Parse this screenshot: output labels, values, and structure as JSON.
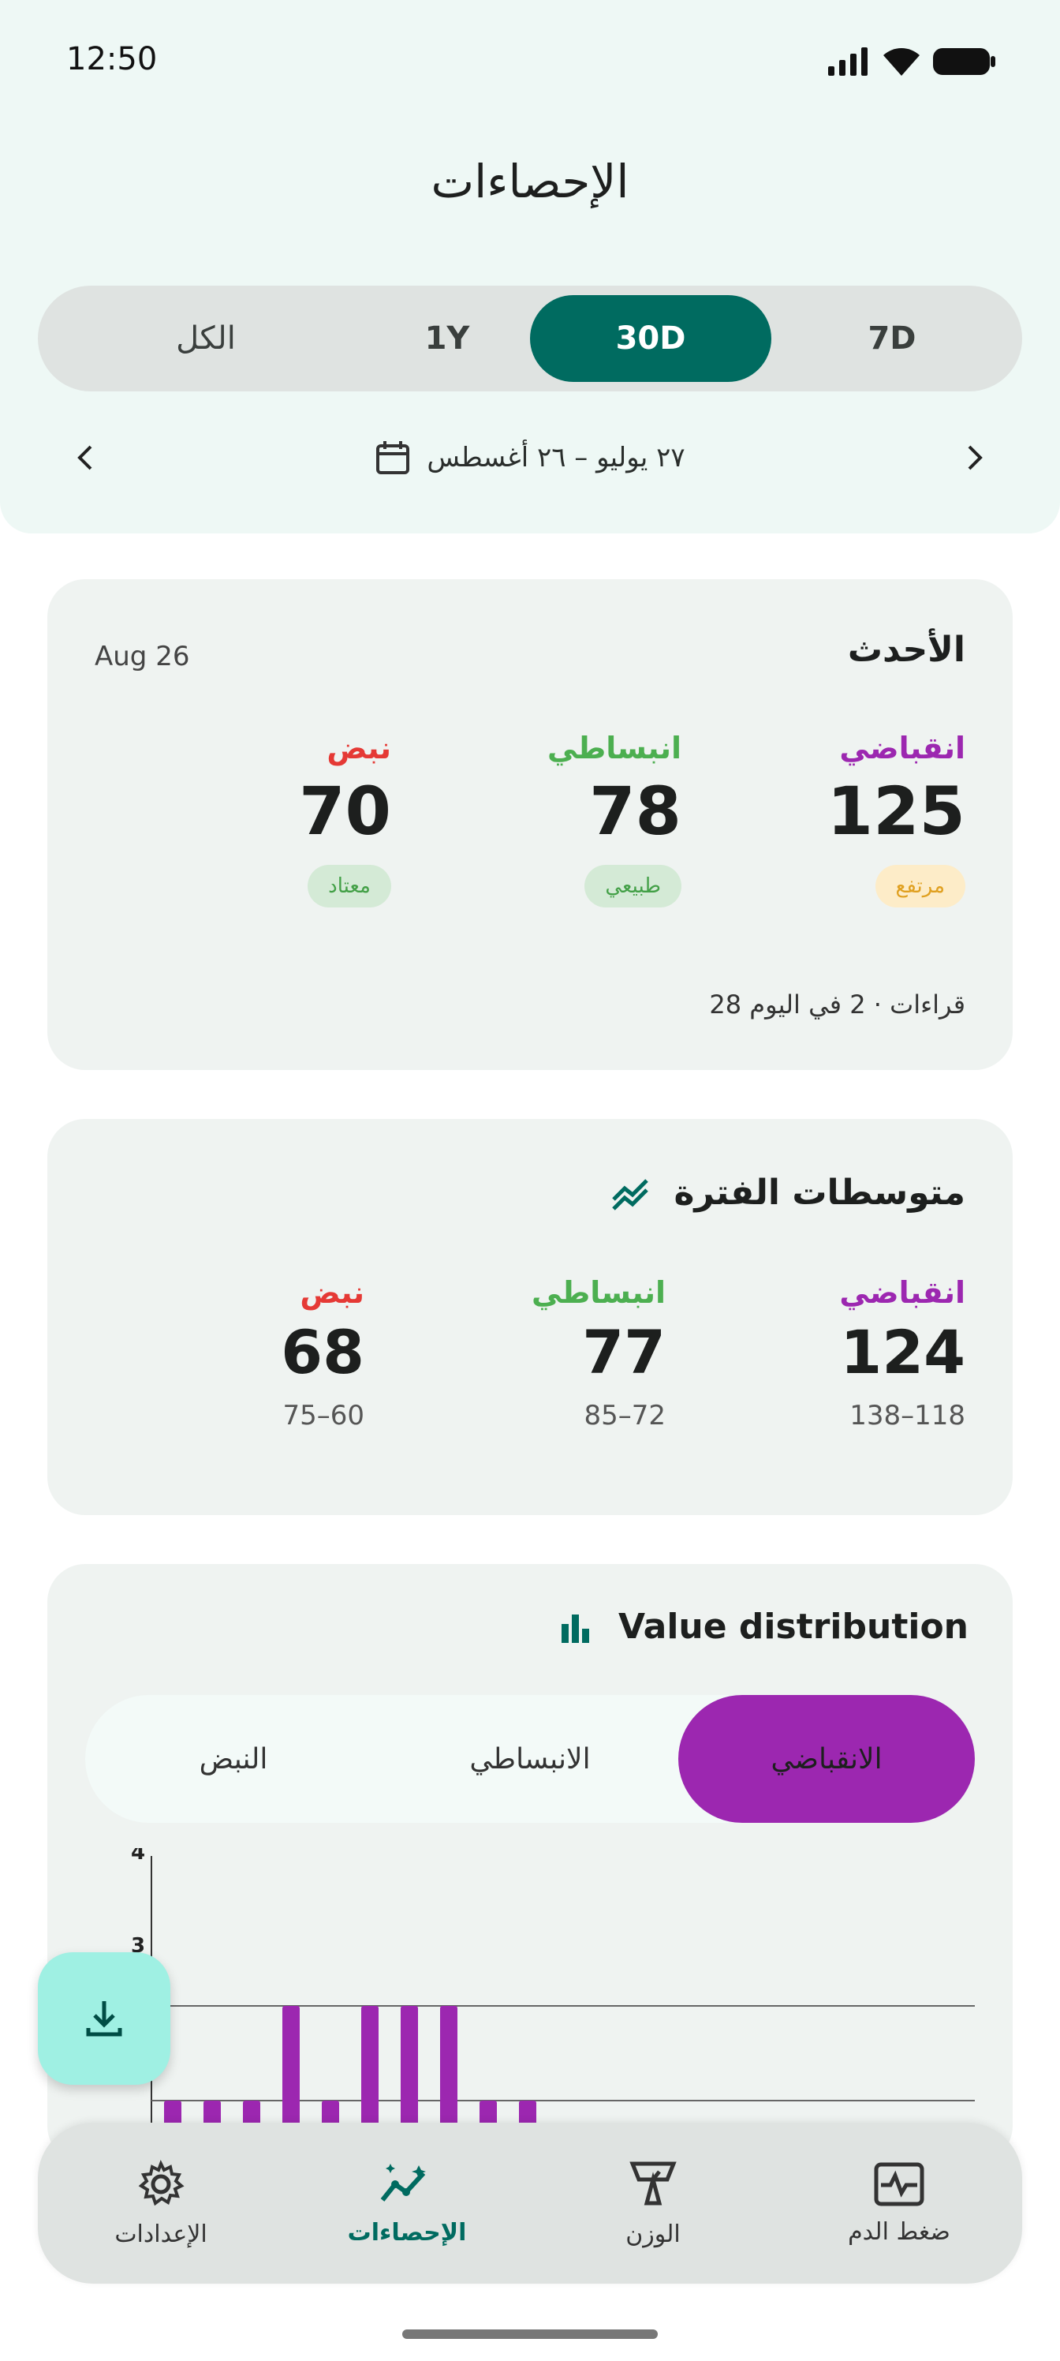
{
  "status_bar": {
    "time": "12:50"
  },
  "header": {
    "title": "الإحصاءات"
  },
  "period_selector": {
    "options": [
      {
        "label": "الكل",
        "active": false
      },
      {
        "label": "1Y",
        "active": false
      },
      {
        "label": "30D",
        "active": true
      },
      {
        "label": "7D",
        "active": false
      }
    ]
  },
  "date_range": {
    "label": "٢٧ يوليو – ٢٦ أغسطس",
    "prev_icon": "chevron-left-icon",
    "next_icon": "chevron-right-icon",
    "calendar_icon": "calendar-icon"
  },
  "latest_card": {
    "title": "الأحدث",
    "date": "Aug 26",
    "systolic": {
      "label": "انقباضي",
      "value": "125",
      "status": "مرتفع"
    },
    "diastolic": {
      "label": "انبساطي",
      "value": "78",
      "status": "طبيعي"
    },
    "pulse": {
      "label": "نبض",
      "value": "70",
      "status": "معتاد"
    },
    "readings_note": "28 قراءات · 2 في اليوم"
  },
  "averages_card": {
    "title": "متوسطات الفترة",
    "icon": "trend-icon",
    "systolic": {
      "label": "انقباضي",
      "value": "124",
      "range": "138–118"
    },
    "diastolic": {
      "label": "انبساطي",
      "value": "77",
      "range": "85–72"
    },
    "pulse": {
      "label": "نبض",
      "value": "68",
      "range": "75–60"
    }
  },
  "distribution_card": {
    "title": "Value distribution",
    "icon": "bar-chart-icon",
    "tabs": [
      {
        "label": "الانقباضي",
        "active": true
      },
      {
        "label": "الانبساطي",
        "active": false
      },
      {
        "label": "النبض",
        "active": false
      }
    ]
  },
  "chart_data": {
    "type": "bar",
    "yticks": [
      "4",
      "3"
    ],
    "values": [
      1,
      1,
      1,
      2,
      1,
      2,
      2,
      2,
      1,
      1
    ],
    "ylim": [
      0,
      4
    ],
    "color": "#9c27b0",
    "grid": true
  },
  "fab": {
    "icon": "download-icon"
  },
  "bottom_nav": {
    "items": [
      {
        "label": "الإعدادات",
        "icon": "gear-icon",
        "active": false
      },
      {
        "label": "الإحصاءات",
        "icon": "stats-icon",
        "active": true
      },
      {
        "label": "الوزن",
        "icon": "scale-icon",
        "active": false
      },
      {
        "label": "ضغط الدم",
        "icon": "heart-monitor-icon",
        "active": false
      }
    ]
  },
  "colors": {
    "primary": "#006b60",
    "systolic": "#9c27b0",
    "diastolic": "#4caf50",
    "pulse": "#e53935"
  }
}
